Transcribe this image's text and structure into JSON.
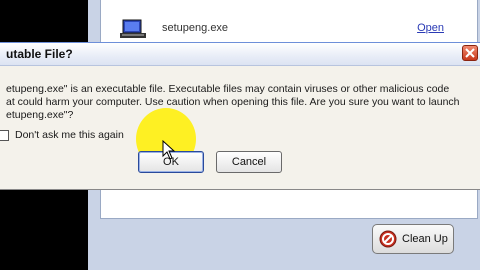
{
  "download": {
    "filename": "setupeng.exe",
    "open_label": "Open"
  },
  "cleanup": {
    "label": "Clean Up"
  },
  "dialog": {
    "title": "utable File?",
    "message_line1": "etupeng.exe\" is an executable file. Executable files may contain viruses or other malicious code",
    "message_line2": "at could harm your computer. Use caution when opening this file. Are you sure you want to launch",
    "message_line3": "etupeng.exe\"?",
    "checkbox_label": "Don't ask me this again",
    "ok_label": "OK",
    "cancel_label": "Cancel"
  },
  "colors": {
    "highlight": "#fff000",
    "link": "#2a3ab5",
    "close_button": "#d04020"
  }
}
